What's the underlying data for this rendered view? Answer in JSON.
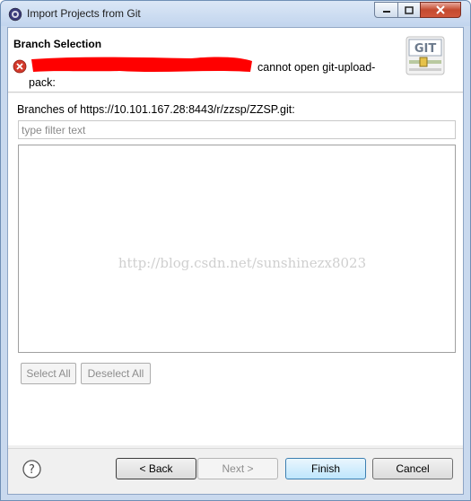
{
  "window": {
    "title": "Import Projects from Git"
  },
  "header": {
    "title": "Branch Selection",
    "message_line1": "cannot open git-upload-",
    "message_line2": "pack:"
  },
  "branches": {
    "label": "Branches of https://10.101.167.28:8443/r/zzsp/ZZSP.git:",
    "filter_placeholder": "type filter text",
    "items": []
  },
  "watermark": "http://blog.csdn.net/sunshinezx8023",
  "selection": {
    "select_all_label": "Select All",
    "deselect_all_label": "Deselect All"
  },
  "footer": {
    "back_label": "< Back",
    "next_label": "Next >",
    "finish_label": "Finish",
    "cancel_label": "Cancel"
  },
  "colors": {
    "error": "#d33a2c",
    "redaction": "#ff0000",
    "accent": "#3c7fb1"
  }
}
